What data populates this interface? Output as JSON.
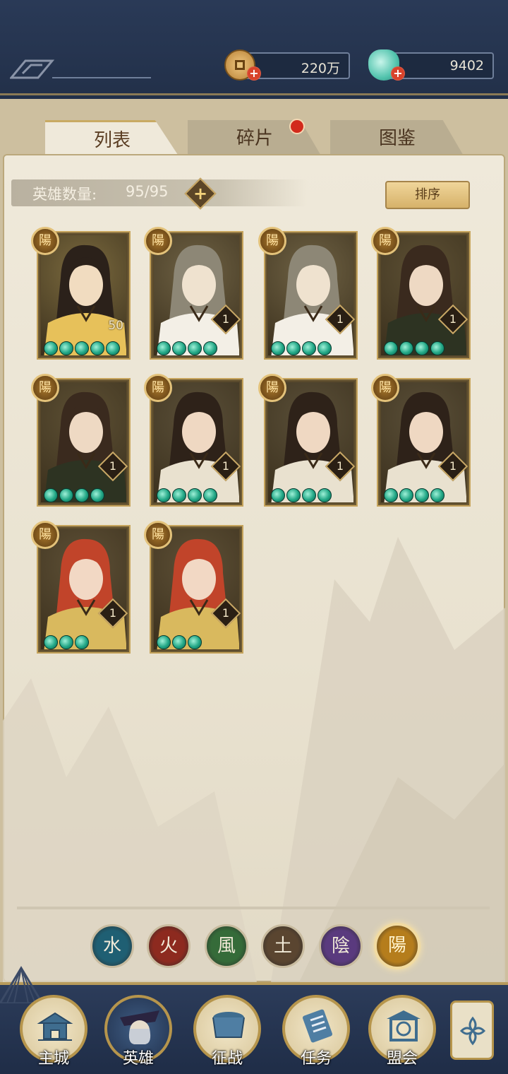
{
  "resources": {
    "coins": "220万",
    "jade": "9402"
  },
  "tabs": [
    {
      "label": "列表",
      "active": true
    },
    {
      "label": "碎片",
      "active": false,
      "has_dot": true
    },
    {
      "label": "图鉴",
      "active": false
    }
  ],
  "hero_count": {
    "label": "英雄数量:",
    "value": "95/95"
  },
  "sort_label": "排序",
  "badge_char": "陽",
  "heroes": [
    {
      "level": "50",
      "stars": 5,
      "style": "plain"
    },
    {
      "level": "1",
      "stars": 4
    },
    {
      "level": "1",
      "stars": 4
    },
    {
      "level": "1",
      "stars": 4
    },
    {
      "level": "1",
      "stars": 4
    },
    {
      "level": "1",
      "stars": 4
    },
    {
      "level": "1",
      "stars": 4
    },
    {
      "level": "1",
      "stars": 4
    },
    {
      "level": "1",
      "stars": 3
    },
    {
      "level": "1",
      "stars": 3
    }
  ],
  "elements": [
    {
      "name": "水",
      "color": "#1f5f73"
    },
    {
      "name": "火",
      "color": "#8d2a1f"
    },
    {
      "name": "風",
      "color": "#356b39"
    },
    {
      "name": "土",
      "color": "#5a4530"
    },
    {
      "name": "陰",
      "color": "#5a3a7e"
    },
    {
      "name": "陽",
      "color": "#b57d1c",
      "selected": true
    }
  ],
  "nav": [
    {
      "label": "主城"
    },
    {
      "label": "英雄",
      "active": true
    },
    {
      "label": "征战"
    },
    {
      "label": "任务"
    },
    {
      "label": "盟会"
    }
  ]
}
